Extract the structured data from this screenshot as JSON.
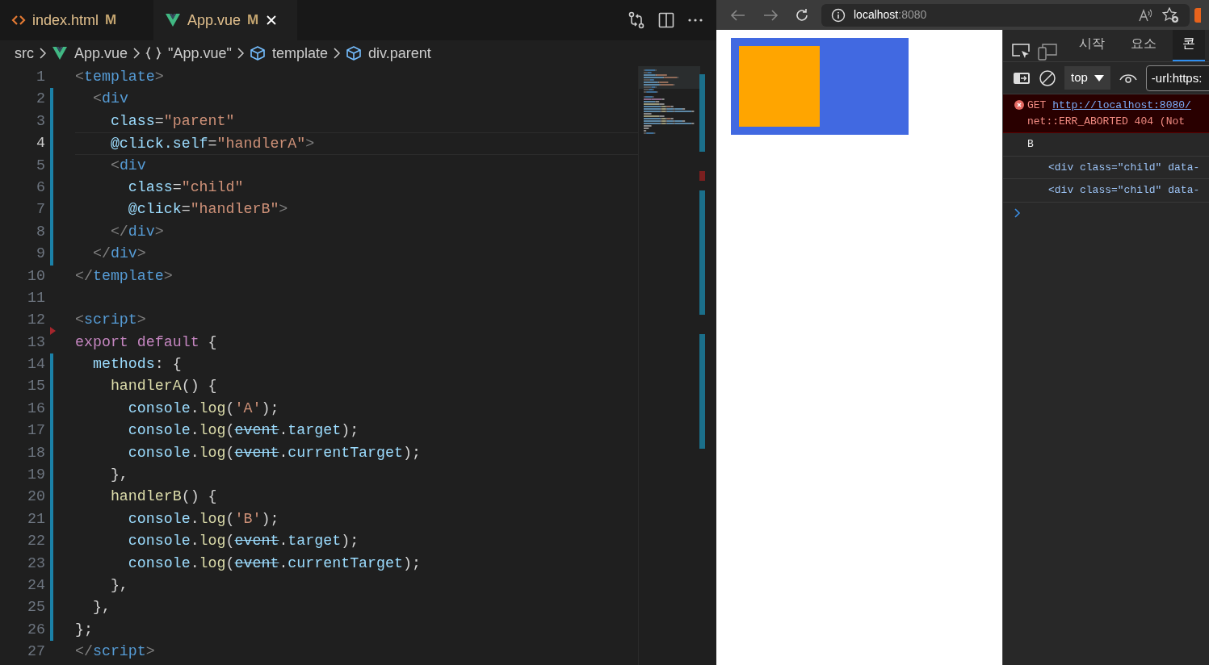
{
  "editor": {
    "tabs": [
      {
        "label": "index.html",
        "kind": "html",
        "status": "M",
        "selected": false
      },
      {
        "label": "App.vue",
        "kind": "vue",
        "status": "M",
        "selected": true
      }
    ],
    "breadcrumbs": [
      {
        "label": "src",
        "kind": "folder"
      },
      {
        "label": "App.vue",
        "kind": "vue"
      },
      {
        "label": "\"App.vue\"",
        "kind": "object"
      },
      {
        "label": "template",
        "kind": "element"
      },
      {
        "label": "div.parent",
        "kind": "element"
      }
    ],
    "lines": [
      {
        "number": "1",
        "current": false,
        "modified": false,
        "deleted": false,
        "tokens": [
          {
            "t": "<",
            "kind": "p"
          },
          {
            "t": "template",
            "kind": "tag"
          },
          {
            "t": ">",
            "kind": "p"
          }
        ]
      },
      {
        "number": "2",
        "current": false,
        "modified": true,
        "deleted": false,
        "tokens": [
          {
            "t": "  <",
            "kind": "p"
          },
          {
            "t": "div",
            "kind": "tag"
          }
        ]
      },
      {
        "number": "3",
        "current": false,
        "modified": true,
        "deleted": false,
        "tokens": [
          {
            "t": "    class",
            "kind": "attr"
          },
          {
            "t": "=",
            "kind": "txt"
          },
          {
            "t": "\"parent\"",
            "kind": "str"
          }
        ]
      },
      {
        "number": "4",
        "current": true,
        "modified": true,
        "deleted": false,
        "tokens": [
          {
            "t": "    @click.self",
            "kind": "attr"
          },
          {
            "t": "=",
            "kind": "txt"
          },
          {
            "t": "\"handlerA\"",
            "kind": "str"
          },
          {
            "t": ">",
            "kind": "p"
          }
        ]
      },
      {
        "number": "5",
        "current": false,
        "modified": true,
        "deleted": false,
        "tokens": [
          {
            "t": "    <",
            "kind": "p"
          },
          {
            "t": "div",
            "kind": "tag"
          }
        ]
      },
      {
        "number": "6",
        "current": false,
        "modified": true,
        "deleted": false,
        "tokens": [
          {
            "t": "      class",
            "kind": "attr"
          },
          {
            "t": "=",
            "kind": "txt"
          },
          {
            "t": "\"child\"",
            "kind": "str"
          }
        ]
      },
      {
        "number": "7",
        "current": false,
        "modified": true,
        "deleted": false,
        "tokens": [
          {
            "t": "      @click",
            "kind": "attr"
          },
          {
            "t": "=",
            "kind": "txt"
          },
          {
            "t": "\"handlerB\"",
            "kind": "str"
          },
          {
            "t": ">",
            "kind": "p"
          }
        ]
      },
      {
        "number": "8",
        "current": false,
        "modified": true,
        "deleted": false,
        "tokens": [
          {
            "t": "    </",
            "kind": "p"
          },
          {
            "t": "div",
            "kind": "tag"
          },
          {
            "t": ">",
            "kind": "p"
          }
        ]
      },
      {
        "number": "9",
        "current": false,
        "modified": true,
        "deleted": false,
        "tokens": [
          {
            "t": "  </",
            "kind": "p"
          },
          {
            "t": "div",
            "kind": "tag"
          },
          {
            "t": ">",
            "kind": "p"
          }
        ]
      },
      {
        "number": "10",
        "current": false,
        "modified": false,
        "deleted": false,
        "tokens": [
          {
            "t": "</",
            "kind": "p"
          },
          {
            "t": "template",
            "kind": "tag"
          },
          {
            "t": ">",
            "kind": "p"
          }
        ]
      },
      {
        "number": "11",
        "current": false,
        "modified": false,
        "deleted": false
      },
      {
        "number": "12",
        "current": false,
        "modified": false,
        "deleted": false,
        "tokens": [
          {
            "t": "<",
            "kind": "p"
          },
          {
            "t": "script",
            "kind": "tag"
          },
          {
            "t": ">",
            "kind": "p"
          }
        ]
      },
      {
        "number": "13",
        "current": false,
        "modified": false,
        "deleted": true,
        "tokens": [
          {
            "t": "export",
            "kind": "kw"
          },
          {
            "t": " default",
            "kind": "kw"
          },
          {
            "t": " {",
            "kind": "txt"
          }
        ]
      },
      {
        "number": "14",
        "current": false,
        "modified": true,
        "deleted": false,
        "tokens": [
          {
            "t": "  methods",
            "kind": "var"
          },
          {
            "t": ": {",
            "kind": "txt"
          }
        ]
      },
      {
        "number": "15",
        "current": false,
        "modified": true,
        "deleted": false,
        "tokens": [
          {
            "t": "    handlerA",
            "kind": "fn"
          },
          {
            "t": "() {",
            "kind": "txt"
          }
        ]
      },
      {
        "number": "16",
        "current": false,
        "modified": true,
        "deleted": false,
        "tokens": [
          {
            "t": "      console",
            "kind": "var"
          },
          {
            "t": ".",
            "kind": "txt"
          },
          {
            "t": "log",
            "kind": "fn"
          },
          {
            "t": "(",
            "kind": "txt"
          },
          {
            "t": "'A'",
            "kind": "str"
          },
          {
            "t": ");",
            "kind": "txt"
          }
        ]
      },
      {
        "number": "17",
        "current": false,
        "modified": true,
        "deleted": false,
        "tokens": [
          {
            "t": "      console",
            "kind": "var"
          },
          {
            "t": ".",
            "kind": "txt"
          },
          {
            "t": "log",
            "kind": "fn"
          },
          {
            "t": "(",
            "kind": "txt"
          },
          {
            "t": "event",
            "kind": "dep"
          },
          {
            "t": ".",
            "kind": "txt"
          },
          {
            "t": "target",
            "kind": "var"
          },
          {
            "t": ");",
            "kind": "txt"
          }
        ]
      },
      {
        "number": "18",
        "current": false,
        "modified": true,
        "deleted": false,
        "tokens": [
          {
            "t": "      console",
            "kind": "var"
          },
          {
            "t": ".",
            "kind": "txt"
          },
          {
            "t": "log",
            "kind": "fn"
          },
          {
            "t": "(",
            "kind": "txt"
          },
          {
            "t": "event",
            "kind": "dep"
          },
          {
            "t": ".",
            "kind": "txt"
          },
          {
            "t": "currentTarget",
            "kind": "var"
          },
          {
            "t": ");",
            "kind": "txt"
          }
        ]
      },
      {
        "number": "19",
        "current": false,
        "modified": true,
        "deleted": false,
        "tokens": [
          {
            "t": "    },",
            "kind": "txt"
          }
        ]
      },
      {
        "number": "20",
        "current": false,
        "modified": true,
        "deleted": false,
        "tokens": [
          {
            "t": "    handlerB",
            "kind": "fn"
          },
          {
            "t": "() {",
            "kind": "txt"
          }
        ]
      },
      {
        "number": "21",
        "current": false,
        "modified": true,
        "deleted": false,
        "tokens": [
          {
            "t": "      console",
            "kind": "var"
          },
          {
            "t": ".",
            "kind": "txt"
          },
          {
            "t": "log",
            "kind": "fn"
          },
          {
            "t": "(",
            "kind": "txt"
          },
          {
            "t": "'B'",
            "kind": "str"
          },
          {
            "t": ");",
            "kind": "txt"
          }
        ]
      },
      {
        "number": "22",
        "current": false,
        "modified": true,
        "deleted": false,
        "tokens": [
          {
            "t": "      console",
            "kind": "var"
          },
          {
            "t": ".",
            "kind": "txt"
          },
          {
            "t": "log",
            "kind": "fn"
          },
          {
            "t": "(",
            "kind": "txt"
          },
          {
            "t": "event",
            "kind": "dep"
          },
          {
            "t": ".",
            "kind": "txt"
          },
          {
            "t": "target",
            "kind": "var"
          },
          {
            "t": ");",
            "kind": "txt"
          }
        ]
      },
      {
        "number": "23",
        "current": false,
        "modified": true,
        "deleted": false,
        "tokens": [
          {
            "t": "      console",
            "kind": "var"
          },
          {
            "t": ".",
            "kind": "txt"
          },
          {
            "t": "log",
            "kind": "fn"
          },
          {
            "t": "(",
            "kind": "txt"
          },
          {
            "t": "event",
            "kind": "dep"
          },
          {
            "t": ".",
            "kind": "txt"
          },
          {
            "t": "currentTarget",
            "kind": "var"
          },
          {
            "t": ");",
            "kind": "txt"
          }
        ]
      },
      {
        "number": "24",
        "current": false,
        "modified": true,
        "deleted": false,
        "tokens": [
          {
            "t": "    },",
            "kind": "txt"
          }
        ]
      },
      {
        "number": "25",
        "current": false,
        "modified": true,
        "deleted": false,
        "tokens": [
          {
            "t": "  },",
            "kind": "txt"
          }
        ]
      },
      {
        "number": "26",
        "current": false,
        "modified": true,
        "deleted": false,
        "tokens": [
          {
            "t": "};",
            "kind": "txt"
          }
        ]
      },
      {
        "number": "27",
        "current": false,
        "modified": false,
        "deleted": false,
        "tokens": [
          {
            "t": "</",
            "kind": "p"
          },
          {
            "t": "script",
            "kind": "tag"
          },
          {
            "t": ">",
            "kind": "p"
          }
        ]
      }
    ]
  },
  "browser": {
    "address": {
      "host": "localhost",
      "port": ":8080"
    },
    "devtools": {
      "tabs": [
        {
          "label": "시작",
          "selected": false
        },
        {
          "label": "요소",
          "selected": false
        },
        {
          "label": "콘",
          "selected": true
        }
      ],
      "context": "top",
      "filter": "-url:https:",
      "console": [
        {
          "kind": "error",
          "parts": [
            {
              "t": "GET ",
              "kind": "txt"
            },
            {
              "t": "http://localhost:8080/",
              "kind": "link"
            }
          ]
        },
        {
          "kind": "error",
          "parts": [
            {
              "t": "net::ERR_ABORTED 404 (Not",
              "kind": "txt"
            }
          ]
        },
        {
          "kind": "log",
          "parts": [
            {
              "t": "B",
              "kind": "txt"
            }
          ]
        },
        {
          "kind": "element",
          "parts": [
            {
              "t": "<div class=\"child\" data-",
              "kind": "txt"
            }
          ]
        },
        {
          "kind": "element",
          "parts": [
            {
              "t": "<div class=\"child\" data-",
              "kind": "txt"
            }
          ]
        },
        {
          "kind": "prompt"
        }
      ]
    }
  }
}
